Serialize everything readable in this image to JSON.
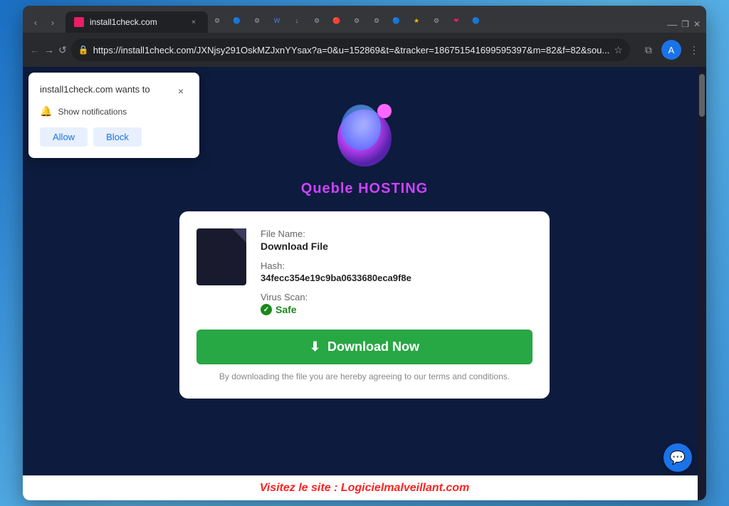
{
  "window": {
    "title": "install1check.com",
    "url": "https://install1check.com/JXNjsy291OskMZJxnYYsax?a=0&u=152869&t=&tracker=186751541699595397&m=82&f=82&sou...",
    "tab_title": "install1check.com"
  },
  "notification_popup": {
    "title": "install1check.com wants to",
    "notification_label": "Show notifications",
    "allow_label": "Allow",
    "block_label": "Block",
    "close_label": "×"
  },
  "page": {
    "brand_name": "Queble HOSTING",
    "file_name_label": "File Name:",
    "file_name_value": "Download File",
    "hash_label": "Hash:",
    "hash_value": "34fecc354e19c9ba0633680eca9f8e",
    "virus_scan_label": "Virus Scan:",
    "safe_label": "Safe",
    "download_button": "Download Now",
    "terms_text": "By downloading the file you are hereby agreeing to our terms and conditions.",
    "bottom_warning": "Visitez le site : Logicielmalveillant.com",
    "chat_icon": "💬"
  },
  "toolbar": {
    "back_icon": "←",
    "forward_icon": "→",
    "reload_icon": "↺",
    "star_icon": "☆",
    "extensions_icon": "⧉",
    "profile_icon": "A",
    "menu_icon": "⋮",
    "new_tab_icon": "+"
  }
}
